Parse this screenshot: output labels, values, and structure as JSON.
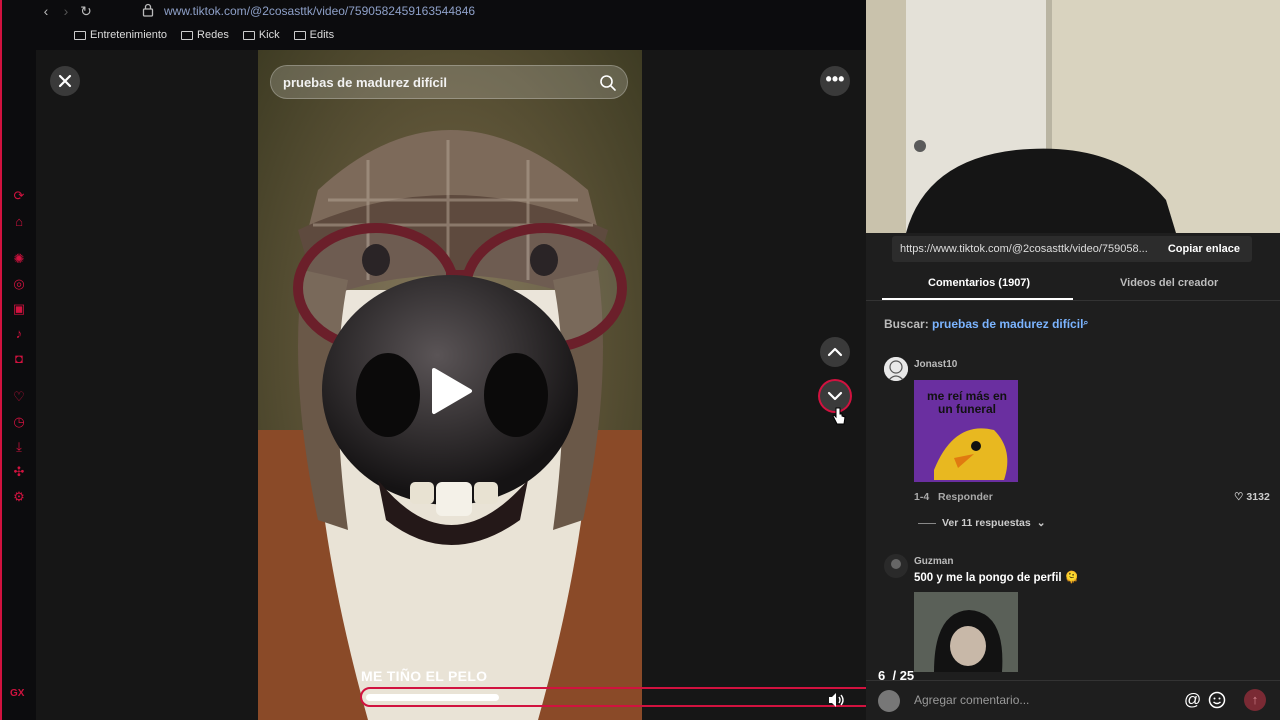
{
  "browser": {
    "url_domain": "www.tiktok.com",
    "url_path": "/@2cosasttk/video/7590582459163544846",
    "bookmarks": [
      "Entretenimiento",
      "Redes",
      "Kick",
      "Edits"
    ]
  },
  "sidebar_icons": [
    "refresh-icon",
    "robot-icon",
    "openai-icon",
    "whatsapp-icon",
    "instagram-icon",
    "tiktok-icon",
    "discord-icon",
    "heart-icon",
    "clock-icon",
    "download-icon",
    "extensions-icon",
    "settings-icon"
  ],
  "sidebar_logo": "GX",
  "video": {
    "search_query": "pruebas de madurez difícil",
    "caption": "ME TIÑO EL PELO",
    "progress": 0.24
  },
  "controls": {
    "more": "•••",
    "position": "6",
    "total": "/ 25"
  },
  "panel": {
    "share_link": "https://www.tiktok.com/@2cosasttk/video/759058...",
    "copy_label": "Copiar enlace",
    "tabs": [
      "Comentarios (1907)",
      "Videos del creador"
    ],
    "search_label": "Buscar:",
    "search_query": "pruebas de madurez difícil",
    "comments": [
      {
        "user": "Jonast10",
        "sticker_text": "me reí más en un funeral",
        "date": "1-4",
        "reply_label": "Responder",
        "likes": "3132",
        "replies_label": "Ver 11 respuestas"
      },
      {
        "user": "Guzman",
        "text": "500 y me la pongo de perfil 🫠"
      }
    ],
    "composer_placeholder": "Agregar comentario...",
    "at_symbol": "@",
    "send_symbol": "↑"
  },
  "colors": {
    "accent": "#d1123f",
    "link": "#7bb4ff",
    "panel": "#1e1e1e"
  }
}
